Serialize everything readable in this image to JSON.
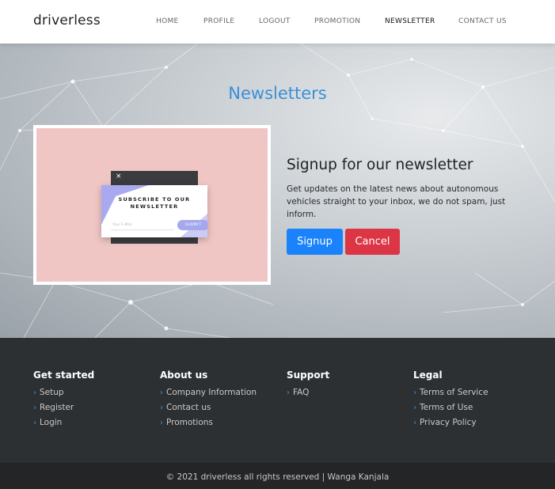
{
  "navbar": {
    "brand": "driverless",
    "items": [
      {
        "label": "HOME",
        "active": false
      },
      {
        "label": "PROFILE",
        "active": false
      },
      {
        "label": "LOGOUT",
        "active": false
      },
      {
        "label": "PROMOTION",
        "active": false
      },
      {
        "label": "NEWSLETTER",
        "active": true
      },
      {
        "label": "CONTACT US",
        "active": false
      }
    ]
  },
  "hero": {
    "title": "Newsletters",
    "image": {
      "close_symbol": "×",
      "popup_title_line1": "SUBSCRIBE TO OUR",
      "popup_title_line2": "NEWSLETTER",
      "email_placeholder": "Your E-Mail",
      "submit_label": "SUBMIT"
    },
    "heading": "Signup for our newsletter",
    "description": "Get updates on the latest news about autonomous vehicles straight to your inbox, we do not spam, just inform.",
    "signup_label": "Signup",
    "cancel_label": "Cancel"
  },
  "footer": {
    "columns": [
      {
        "title": "Get started",
        "links": [
          "Setup",
          "Register",
          "Login"
        ]
      },
      {
        "title": "About us",
        "links": [
          "Company Information",
          "Contact us",
          "Promotions"
        ]
      },
      {
        "title": "Support",
        "links": [
          "FAQ"
        ]
      },
      {
        "title": "Legal",
        "links": [
          "Terms of Service",
          "Terms of Use",
          "Privacy Policy"
        ]
      }
    ],
    "chevron": "›",
    "copyright": "© 2021 driverless all rights reserved | Wanga Kanjala"
  },
  "colors": {
    "accent": "#3a8fd6",
    "signup_button": "#1a82fb",
    "cancel_button": "#dc3545",
    "footer_bg": "#2d3033",
    "copyright_bg": "#232527"
  }
}
